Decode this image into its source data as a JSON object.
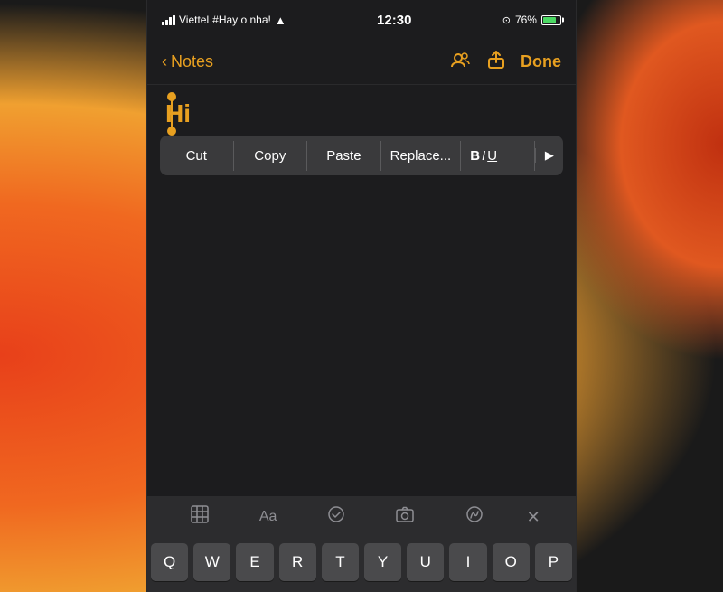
{
  "statusBar": {
    "carrier": "Viettel",
    "network": "#Hay o nha!",
    "time": "12:30",
    "battery": "76%"
  },
  "navBar": {
    "backLabel": "Notes",
    "doneLabel": "Done"
  },
  "noteContent": {
    "text": "Hi"
  },
  "contextMenu": {
    "cut": "Cut",
    "copy": "Copy",
    "paste": "Paste",
    "replace": "Replace...",
    "biu": "BIU",
    "more": "▶"
  },
  "toolbar": {
    "table": "⊞",
    "format": "Aa",
    "checklist": "⊙",
    "camera": "⊙",
    "handwriting": "⊙",
    "close": "✕"
  },
  "keyboard": {
    "row1": [
      "Q",
      "W",
      "E",
      "R",
      "T",
      "Y",
      "U",
      "I",
      "O",
      "P"
    ]
  }
}
